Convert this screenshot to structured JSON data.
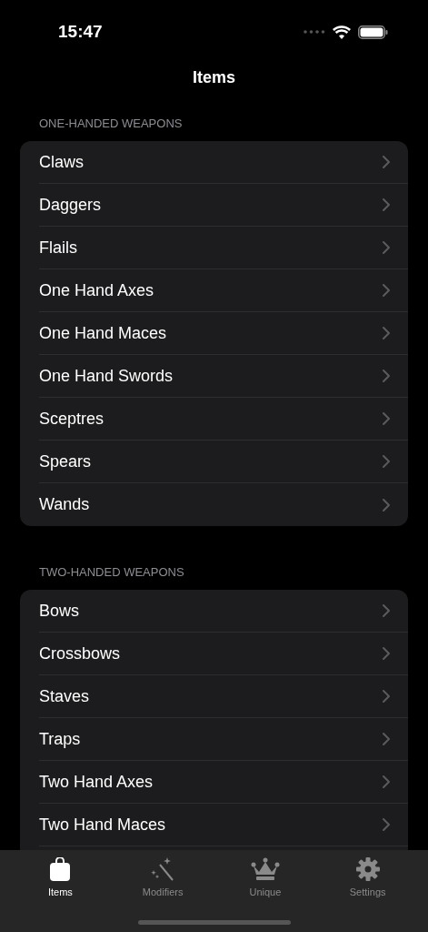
{
  "status_bar": {
    "time": "15:47"
  },
  "nav": {
    "title": "Items"
  },
  "sections": [
    {
      "header": "ONE-HANDED WEAPONS",
      "items": [
        "Claws",
        "Daggers",
        "Flails",
        "One Hand Axes",
        "One Hand Maces",
        "One Hand Swords",
        "Sceptres",
        "Spears",
        "Wands"
      ]
    },
    {
      "header": "TWO-HANDED WEAPONS",
      "items": [
        "Bows",
        "Crossbows",
        "Staves",
        "Traps",
        "Two Hand Axes",
        "Two Hand Maces"
      ]
    }
  ],
  "tab_bar": [
    {
      "label": "Items",
      "kind": "bag",
      "selected": true
    },
    {
      "label": "Modifiers",
      "kind": "wand",
      "selected": false
    },
    {
      "label": "Unique",
      "kind": "crown",
      "selected": false
    },
    {
      "label": "Settings",
      "kind": "gear",
      "selected": false
    }
  ]
}
